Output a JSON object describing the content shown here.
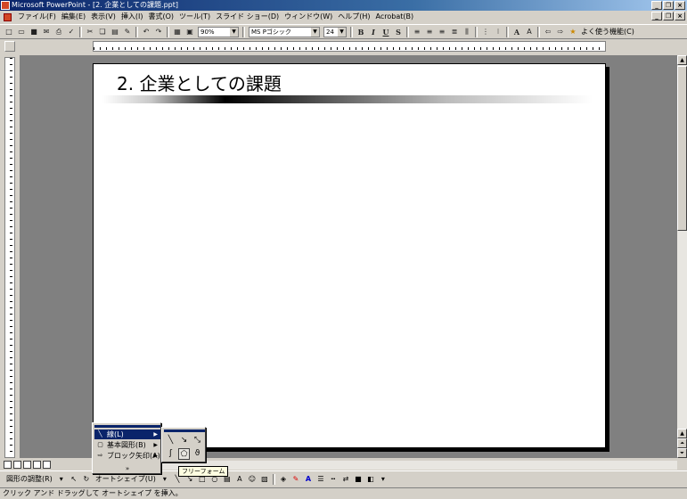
{
  "window": {
    "title": "Microsoft PowerPoint - [2. 企業としての課題.ppt]"
  },
  "menu": {
    "items": [
      "ファイル(F)",
      "編集(E)",
      "表示(V)",
      "挿入(I)",
      "書式(O)",
      "ツール(T)",
      "スライド ショー(D)",
      "ウィンドウ(W)",
      "ヘルプ(H)",
      "Acrobat(B)"
    ]
  },
  "toolbar": {
    "zoom": "90%",
    "font_name": "MS Pゴシック",
    "font_size": "24",
    "help_text": "よく使う機能(C)"
  },
  "slide": {
    "title": "2. 企業としての課題"
  },
  "drawing_toolbar": {
    "draw_label": "図形の調整(R)",
    "autoshape_label": "オートシェイプ(U)"
  },
  "autoshape_menu": {
    "items": [
      {
        "label": "線(L)"
      },
      {
        "label": "基本図形(B)"
      },
      {
        "label": "ブロック矢印(A)"
      }
    ],
    "more": "»"
  },
  "lines_submenu": {
    "icons": [
      "line-icon",
      "arrow-icon",
      "double-arrow-icon",
      "curve-icon",
      "freeform-icon",
      "scribble-icon"
    ]
  },
  "tooltip": {
    "text": "フリーフォーム"
  },
  "status": {
    "text": "クリック アンド ドラッグして オートシェイプ を挿入。"
  }
}
